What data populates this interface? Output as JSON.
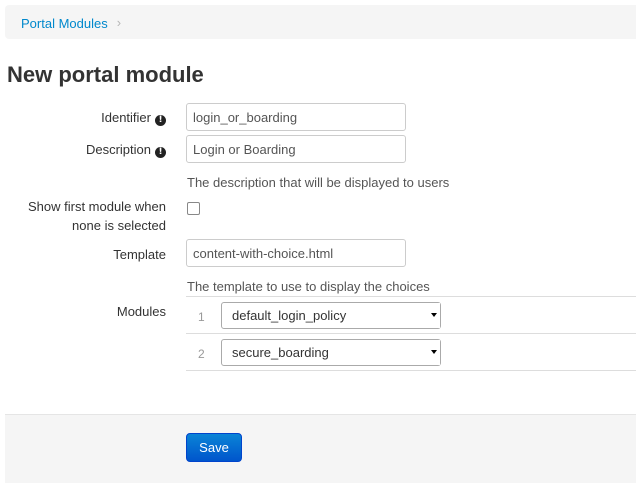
{
  "breadcrumb": {
    "link_label": "Portal Modules",
    "separator": "›"
  },
  "page_title": "New portal module",
  "form": {
    "identifier": {
      "label": "Identifier",
      "info_icon": "exclamation-circle-icon",
      "value": "login_or_boarding"
    },
    "description": {
      "label": "Description",
      "info_icon": "exclamation-circle-icon",
      "value": "Login or Boarding",
      "help": "The description that will be displayed to users"
    },
    "show_first_module": {
      "label_line1": "Show first module when",
      "label_line2": "none is selected",
      "checked": false
    },
    "template": {
      "label": "Template",
      "value": "content-with-choice.html",
      "help": "The template to use to display the choices"
    },
    "modules": {
      "label": "Modules",
      "rows": [
        {
          "index": "1",
          "selected": "default_login_policy"
        },
        {
          "index": "2",
          "selected": "secure_boarding"
        }
      ]
    }
  },
  "actions": {
    "save_label": "Save"
  },
  "colors": {
    "link": "#0088cc",
    "primary_button": "#0066cc",
    "panel_bg": "#f5f5f5"
  }
}
